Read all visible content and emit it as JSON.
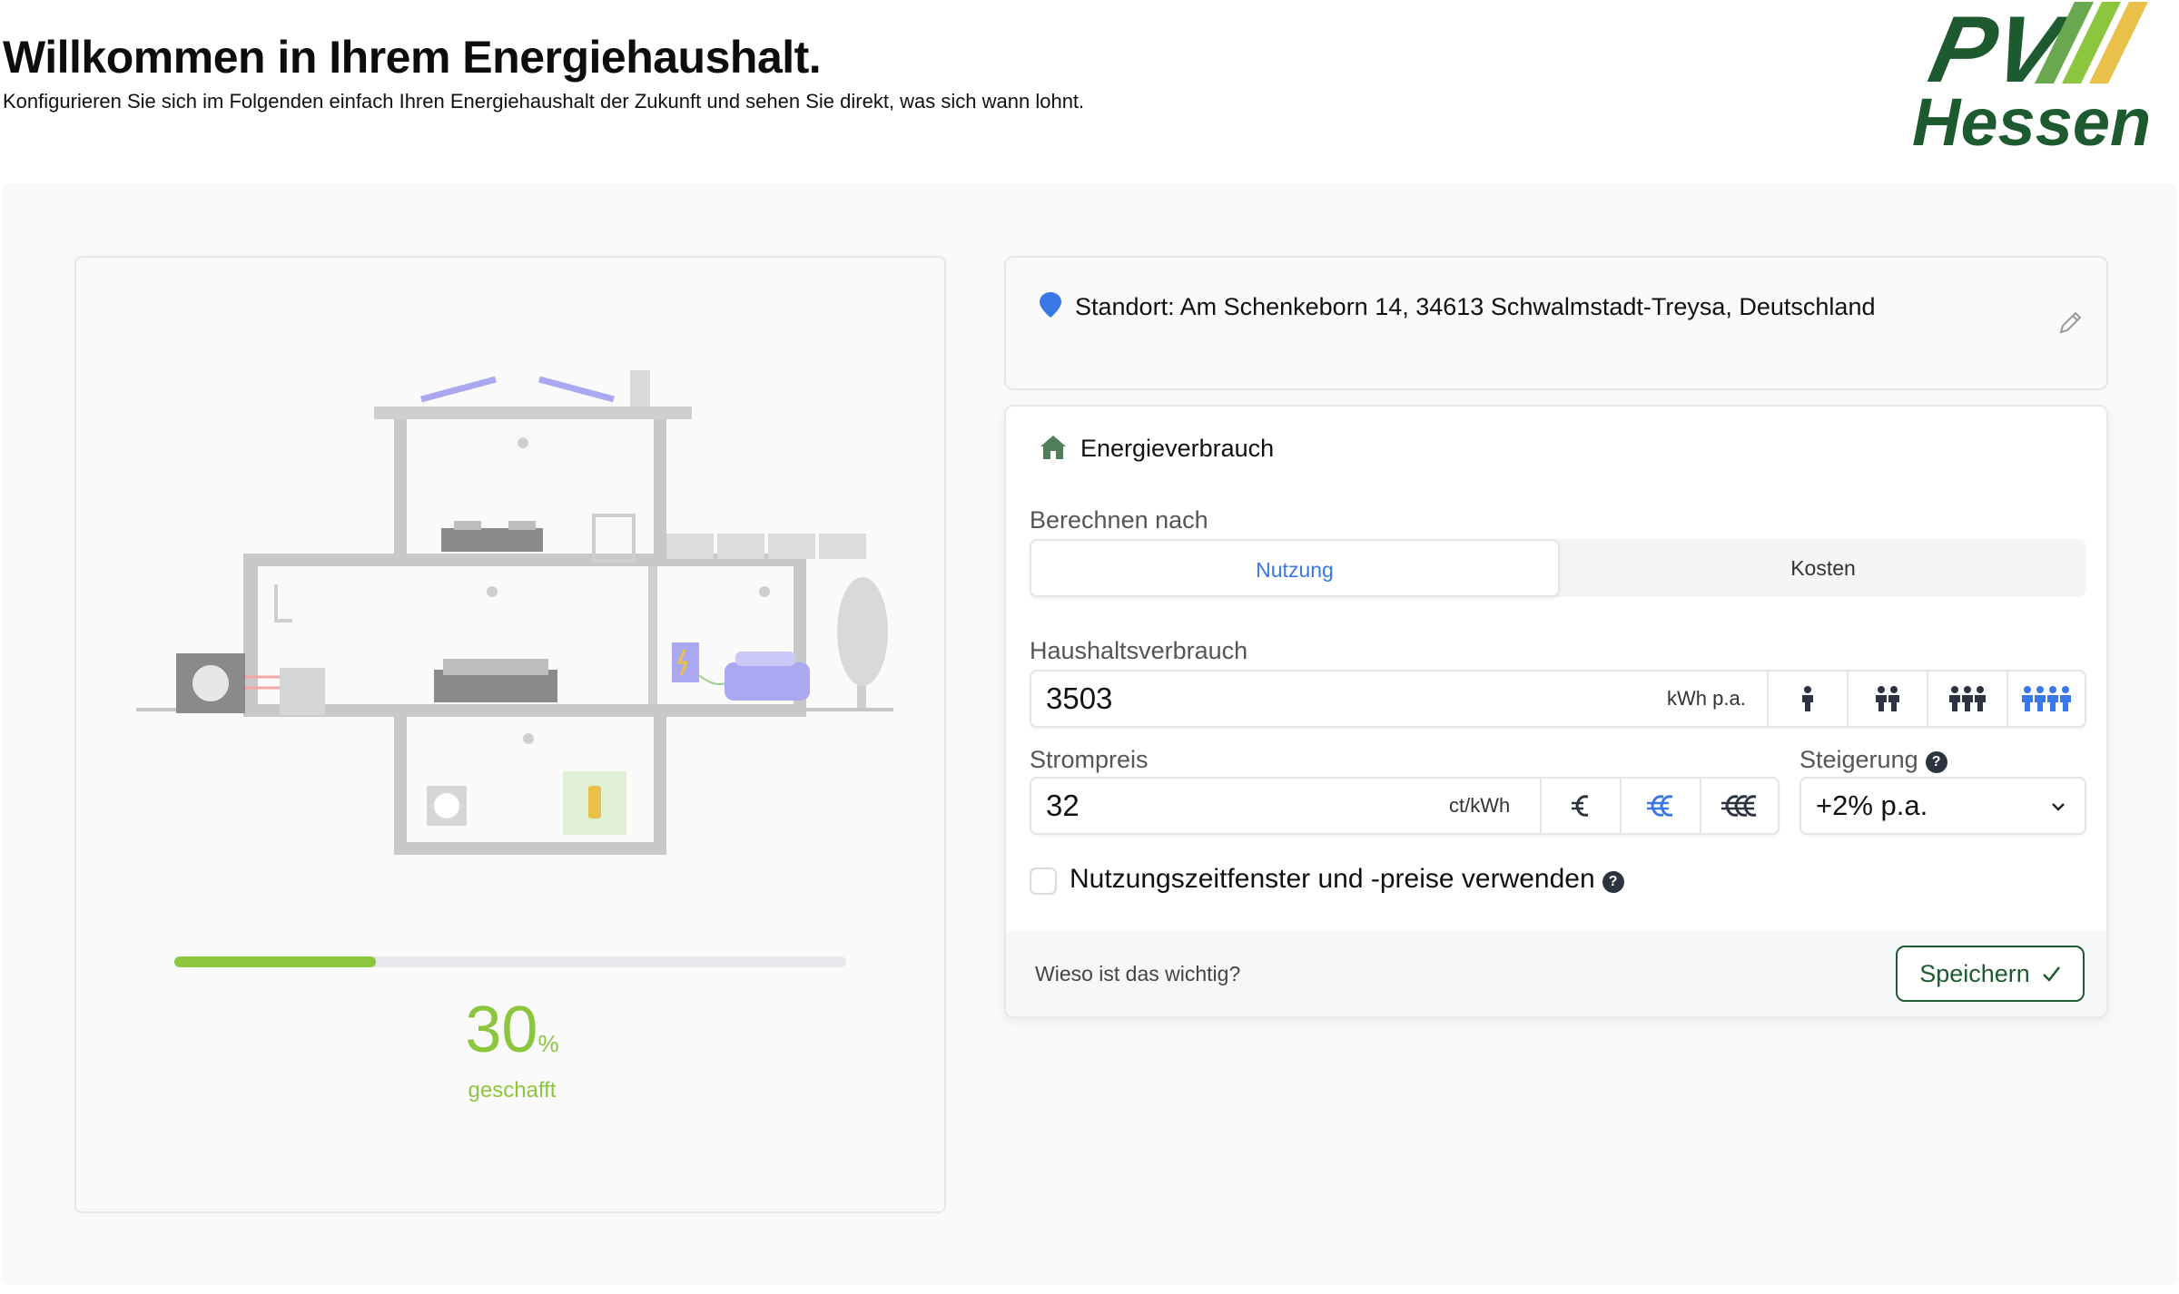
{
  "header": {
    "title": "Willkommen in Ihrem Energiehaushalt.",
    "subtitle": "Konfigurieren Sie sich im Folgenden einfach Ihren Energiehaushalt der Zukunft und sehen Sie direkt, was sich wann lohnt.",
    "logo_text_top": "PV",
    "logo_text_bottom": "Hessen"
  },
  "progress": {
    "fraction": 0.3,
    "value": "30",
    "unit": "%",
    "label": "geschafft"
  },
  "location": {
    "text": "Standort: Am Schenkeborn 14, 34613 Schwalmstadt-Treysa, Deutschland"
  },
  "energy": {
    "heading": "Energieverbrauch",
    "calc_label": "Berechnen nach",
    "tabs": [
      {
        "label": "Nutzung",
        "active": true
      },
      {
        "label": "Kosten",
        "active": false
      }
    ],
    "household_label": "Haushaltsverbrauch",
    "household_value": "3503",
    "household_unit": "kWh p.a.",
    "persons": [
      "1-person-icon",
      "2-persons-icon",
      "3-persons-icon",
      "4-persons-icon"
    ],
    "persons_selected": 4,
    "price_label": "Strompreis",
    "price_value": "32",
    "price_unit": "ct/kWh",
    "price_levels": [
      "euro-icon",
      "double-euro-icon",
      "triple-euro-icon"
    ],
    "price_level_selected": 2,
    "increase_label": "Steigerung",
    "increase_value": "+2% p.a.",
    "help_glyph": "?",
    "tou_label": "Nutzungszeitfenster und -preise verwenden",
    "tou_checked": false,
    "why_link": "Wieso ist das wichtig?",
    "save_label": "Speichern"
  },
  "colors": {
    "accent_blue": "#3a78e6",
    "progress_green": "#8cc63f",
    "brand_dark_green": "#1d5a2f"
  }
}
